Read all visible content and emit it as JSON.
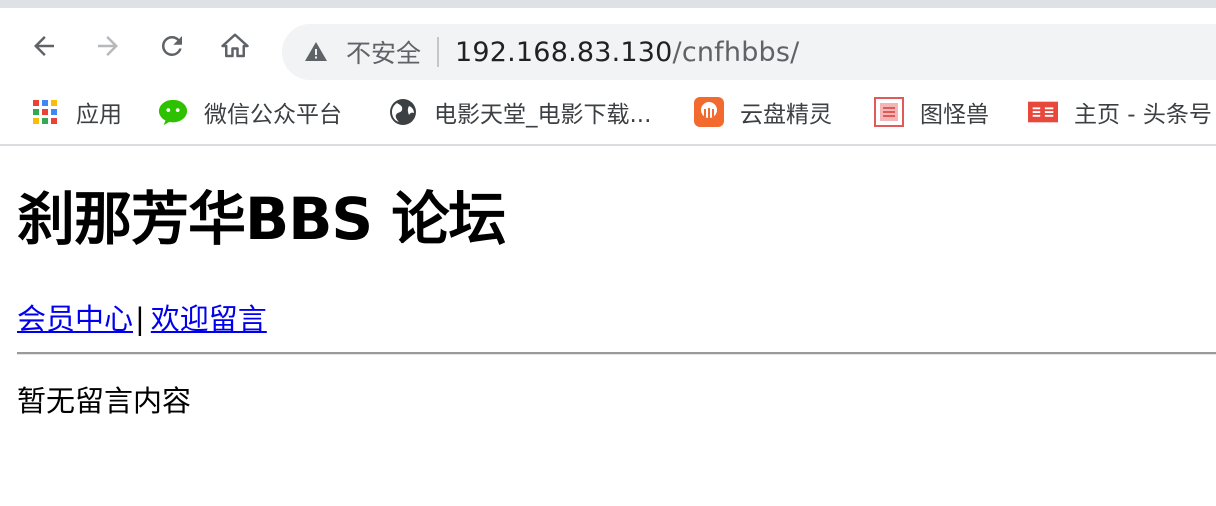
{
  "browser": {
    "security_label": "不安全",
    "url_host": "192.168.83.130",
    "url_path": "/cnfhbbs/",
    "bookmarks": [
      {
        "label": "应用",
        "icon": "apps-grid-icon"
      },
      {
        "label": "微信公众平台",
        "icon": "wechat-icon"
      },
      {
        "label": "电影天堂_电影下载...",
        "icon": "globe-icon"
      },
      {
        "label": "云盘精灵",
        "icon": "cloud-disk-icon"
      },
      {
        "label": "图怪兽",
        "icon": "tuguaishou-icon"
      },
      {
        "label": "主页 - 头条号",
        "icon": "toutiao-icon"
      }
    ]
  },
  "page": {
    "title": "刹那芳华BBS 论坛",
    "nav": {
      "member_center": "会员中心",
      "separator": "|",
      "leave_message": "欢迎留言"
    },
    "empty_message": "暂无留言内容"
  },
  "colors": {
    "link": "#0000ee",
    "omnibox_bg": "#f1f3f4",
    "wechat_green": "#2dc100",
    "cloud_orange": "#f26a2e",
    "toutiao_red": "#e8473c"
  }
}
